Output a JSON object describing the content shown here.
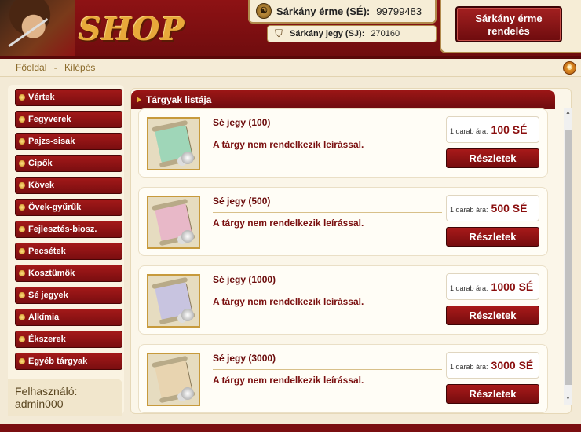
{
  "header": {
    "logo_text": "SHOP",
    "currency": {
      "icon_glyph": "☯",
      "label": "Sárkány érme (SÉ):",
      "value": "99799483"
    },
    "ticket": {
      "icon_glyph": "⛉",
      "label": "Sárkány jegy (SJ):",
      "value": "270160"
    },
    "order_button_line1": "Sárkány érme",
    "order_button_line2": "rendelés"
  },
  "nav": {
    "home": "Főoldal",
    "separator": "-",
    "logout": "Kilépés",
    "globe_glyph": "✺"
  },
  "sidebar": {
    "items": [
      {
        "label": "Vértek"
      },
      {
        "label": "Fegyverek"
      },
      {
        "label": "Pajzs-sisak"
      },
      {
        "label": "Cipők"
      },
      {
        "label": "Kövek"
      },
      {
        "label": "Övek-gyűrűk"
      },
      {
        "label": "Fejlesztés-biosz."
      },
      {
        "label": "Pecsétek"
      },
      {
        "label": "Kosztümök"
      },
      {
        "label": "Sé jegyek"
      },
      {
        "label": "Alkímia"
      },
      {
        "label": "Ékszerek"
      },
      {
        "label": "Egyéb tárgyak"
      }
    ],
    "user_label": "Felhasználó:",
    "username": "admin000"
  },
  "main": {
    "title": "Tárgyak listája",
    "items": [
      {
        "name": "Sé jegy (100)",
        "description": "A tárgy nem rendelkezik leírással.",
        "price_label": "1 darab ára:",
        "price": "100 SÉ",
        "button": "Részletek",
        "scroll_color": "#9fd6b8"
      },
      {
        "name": "Sé jegy (500)",
        "description": "A tárgy nem rendelkezik leírással.",
        "price_label": "1 darab ára:",
        "price": "500 SÉ",
        "button": "Részletek",
        "scroll_color": "#e8b8c8"
      },
      {
        "name": "Sé jegy (1000)",
        "description": "A tárgy nem rendelkezik leírással.",
        "price_label": "1 darab ára:",
        "price": "1000 SÉ",
        "button": "Részletek",
        "scroll_color": "#c8c4e0"
      },
      {
        "name": "Sé jegy (3000)",
        "description": "A tárgy nem rendelkezik leírással.",
        "price_label": "1 darab ára:",
        "price": "3000 SÉ",
        "button": "Részletek",
        "scroll_color": "#e8d4b0"
      }
    ]
  },
  "colors": {
    "brand_red": "#8e1214",
    "gold": "#e8a93a",
    "panel": "#f3ead6"
  }
}
